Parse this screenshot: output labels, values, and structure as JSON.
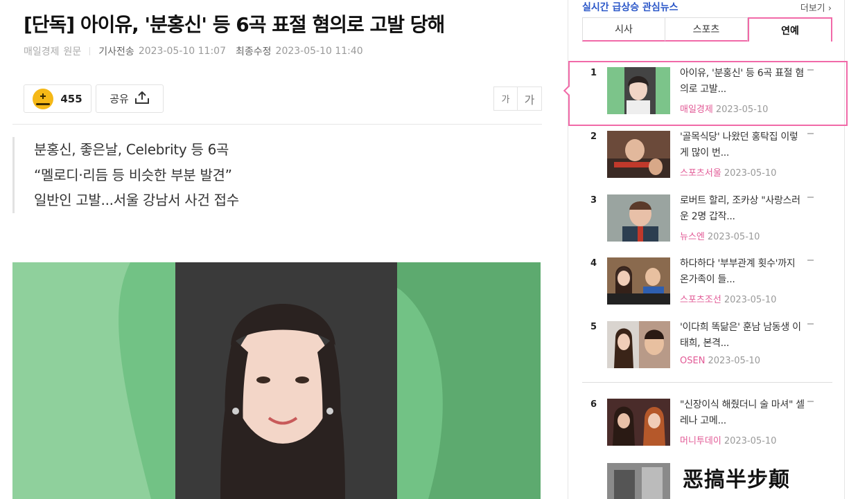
{
  "article": {
    "title": "[단독] 아이유, '분홍신' 등 6곡 표절 혐의로 고발 당해",
    "source": "매일경제",
    "original_label": "원문",
    "sent_label": "기사전송",
    "sent_date": "2023-05-10 11:07",
    "modified_label": "최종수정",
    "modified_date": "2023-05-10 11:40",
    "reaction_count": "455",
    "share_label": "공유",
    "font_small": "가",
    "font_large": "가",
    "summary": [
      "분홍신, 좋은날, Celebrity 등 6곡",
      "“멜로디·리듬 등 비슷한 부분 발견”",
      "일반인 고발...서울 강남서 사건 접수"
    ]
  },
  "sidebar": {
    "title": "실시간 급상승 관심뉴스",
    "more": "더보기",
    "tabs": [
      "시사",
      "스포츠",
      "연예"
    ],
    "active_tab": "연예",
    "items": [
      {
        "rank": "1",
        "headline": "아이유, '분홍신' 등 6곡 표절 혐의로 고발...",
        "publisher": "매일경제",
        "date": "2023-05-10"
      },
      {
        "rank": "2",
        "headline": "'골목식당' 나왔던 홍탁집 이렇게 많이 번...",
        "publisher": "스포츠서울",
        "date": "2023-05-10"
      },
      {
        "rank": "3",
        "headline": "로버트 할리, 조카상 \"사랑스러운 2명 갑작...",
        "publisher": "뉴스엔",
        "date": "2023-05-10"
      },
      {
        "rank": "4",
        "headline": "하다하다 '부부관계 횟수'까지 온가족이 들...",
        "publisher": "스포츠조선",
        "date": "2023-05-10"
      },
      {
        "rank": "5",
        "headline": "'이다희 똑닮은' 훈남 남동생 이태희, 본격...",
        "publisher": "OSEN",
        "date": "2023-05-10"
      },
      {
        "rank": "6",
        "headline": "\"신장이식 해줬더니 술 마셔\" 셀레나 고메...",
        "publisher": "머니투데이",
        "date": "2023-05-10"
      }
    ]
  },
  "watermark": "恶搞半步颠",
  "colors": {
    "accent_pink": "#f169a8",
    "publisher_pink": "#e25a96",
    "title_blue": "#2b57c8",
    "reaction_yellow": "#f5b817"
  },
  "icons": [
    "reaction-icon",
    "share-upload-icon",
    "chevron-right-icon"
  ]
}
